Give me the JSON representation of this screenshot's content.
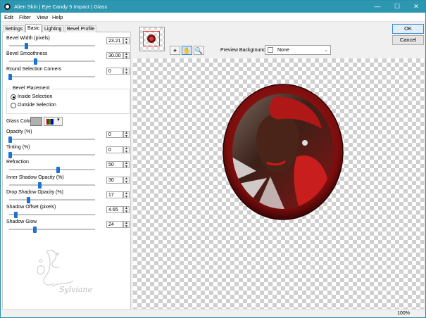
{
  "window": {
    "title": "Alien Skin | Eye Candy 5 Impact | Glass",
    "minimize": "—",
    "maximize": "☐",
    "close": "✕"
  },
  "menu": [
    "Edit",
    "Filter",
    "View",
    "Help"
  ],
  "tabs": [
    "Settings",
    "Basic",
    "Lighting",
    "Bevel Profile"
  ],
  "controls": {
    "bevel_width": {
      "label": "Bevel Width (pixels)",
      "value": "23.21",
      "level": 0.19
    },
    "bevel_smoothness": {
      "label": "Bevel Smoothness",
      "value": "30.00",
      "level": 0.3
    },
    "round_corners": {
      "label": "Round Selection Corners",
      "value": "0",
      "level": 0.0
    },
    "bevel_placement": {
      "title": "Bevel Placement",
      "options": [
        "Inside Selection",
        "Outside Selection"
      ],
      "selected": 0
    },
    "glass_color": {
      "label": "Glass Color",
      "color": "#b0b0b0"
    },
    "opacity": {
      "label": "Opacity (%)",
      "value": "0",
      "level": 0.0
    },
    "tinting": {
      "label": "Tinting (%)",
      "value": "0",
      "level": 0.0
    },
    "refraction": {
      "label": "Refraction",
      "value": "50",
      "level": 0.57
    },
    "inner_shadow_opacity": {
      "label": "Inner Shadow Opacity (%)",
      "value": "30",
      "level": 0.35
    },
    "drop_shadow_opacity": {
      "label": "Drop Shadow Opacity (%)",
      "value": "17",
      "level": 0.22
    },
    "shadow_offset": {
      "label": "Shadow Offset (pixels)",
      "value": "4.65",
      "level": 0.07
    },
    "shadow_glow": {
      "label": "Shadow Glow",
      "value": "24",
      "level": 0.29
    }
  },
  "watermark": {
    "text": "Sylviane"
  },
  "preview": {
    "background_label": "Preview Background:",
    "background_value": "None"
  },
  "buttons": {
    "ok": "OK",
    "cancel": "Cancel"
  },
  "status": {
    "zoom": "100%"
  },
  "colors": {
    "titlebar": "#2d97b2",
    "accent": "#1a75d1",
    "frame": "#8b0d0d"
  }
}
